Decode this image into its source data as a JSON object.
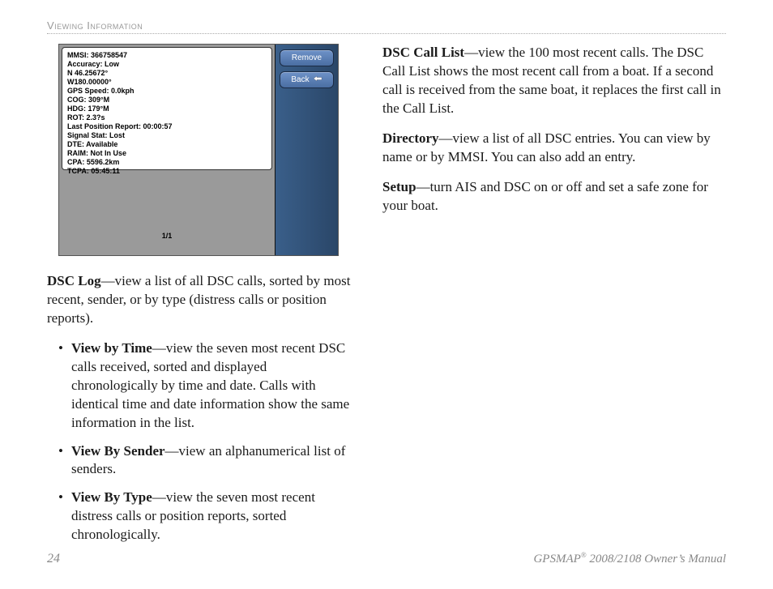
{
  "header": {
    "title": "Viewing Information"
  },
  "device": {
    "info_lines": [
      "MMSI: 366758547",
      "Accuracy: Low",
      "N 46.25672°",
      "W180.00000°",
      "GPS Speed: 0.0kph",
      "COG: 309°M",
      "HDG: 179°M",
      "ROT: 2.3?s",
      "Last Position Report: 00:00:57",
      "Signal Stat: Lost",
      "DTE: Available",
      "RAIM: Not In Use",
      "CPA: 5596.2km",
      "TCPA: 05:45:11"
    ],
    "page_indicator": "1/1",
    "buttons": {
      "remove": "Remove",
      "back": "Back"
    }
  },
  "left_text": {
    "dsc_log_bold": "DSC Log",
    "dsc_log_rest": "—view a list of all DSC calls, sorted by most recent, sender, or by type (distress calls or position reports).",
    "bullets": [
      {
        "bold": "View by Time",
        "rest": "—view the seven most recent DSC calls received, sorted and displayed chronologically by time and date. Calls with identical time and date information show the same information in the list."
      },
      {
        "bold": "View By Sender",
        "rest": "—view an alphanumerical list of senders."
      },
      {
        "bold": "View By Type",
        "rest": "—view the seven most recent distress calls or position reports, sorted chronologically."
      }
    ]
  },
  "right_text": {
    "items": [
      {
        "bold": "DSC Call List",
        "rest": "—view the 100 most recent calls. The DSC Call List shows the most recent call from a boat. If a second call is received from the same boat, it replaces the first call in the Call List."
      },
      {
        "bold": "Directory",
        "rest": "—view  a list of all DSC entries. You can view by name or by MMSI. You can also add an entry."
      },
      {
        "bold": "Setup",
        "rest": "—turn AIS and DSC on or off and set a safe zone for your boat."
      }
    ]
  },
  "footer": {
    "page": "24",
    "product": "GPSMAP",
    "reg": "®",
    "tail": " 2008/2108  Owner’s Manual"
  }
}
